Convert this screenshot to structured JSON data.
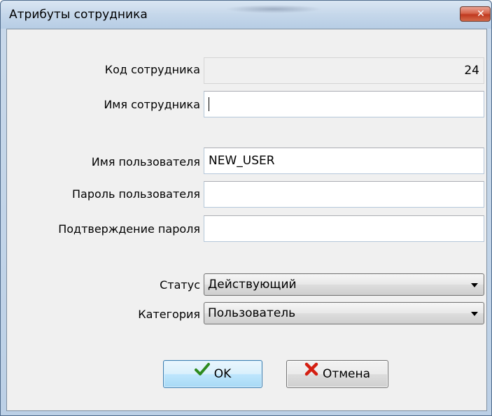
{
  "window": {
    "title": "Атрибуты сотрудника",
    "close_icon": "close-icon"
  },
  "form": {
    "employee_code_label": "Код сотрудника",
    "employee_code_value": "24",
    "employee_name_label": "Имя сотрудника",
    "employee_name_value": "",
    "username_label": "Имя пользователя",
    "username_value": "NEW_USER",
    "password_label": "Пароль пользователя",
    "password_value": "",
    "password_confirm_label": "Подтверждение пароля",
    "password_confirm_value": "",
    "status_label": "Статус",
    "status_value": "Действующий",
    "category_label": "Категория",
    "category_value": "Пользователь"
  },
  "buttons": {
    "ok_label": "OK",
    "ok_icon": "checkmark-icon",
    "cancel_label": "Отмена",
    "cancel_icon": "cross-icon"
  },
  "colors": {
    "ok_check": "#2e8b1f",
    "cancel_cross": "#d41f12",
    "close_button": "#c0391f"
  }
}
